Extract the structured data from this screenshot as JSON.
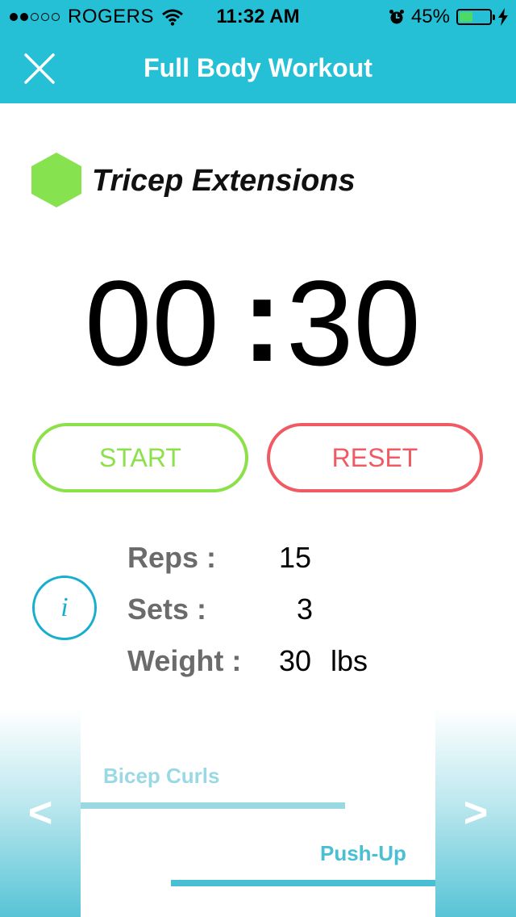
{
  "status_bar": {
    "carrier": "ROGERS",
    "time": "11:32 AM",
    "battery_percent_label": "45%",
    "battery_level": 0.45,
    "signal_bars": 2,
    "icons": [
      "signal-dots-icon",
      "wifi-icon",
      "alarm-clock-icon",
      "battery-icon",
      "charging-bolt-icon"
    ]
  },
  "header": {
    "title": "Full Body Workout",
    "close_icon": "close-icon",
    "background": "#25bfd6"
  },
  "exercise": {
    "name": "Tricep Extensions",
    "badge_icon": "hexagon-icon",
    "badge_color": "#86e34f"
  },
  "timer": {
    "minutes": "00",
    "separator": ":",
    "seconds": "30"
  },
  "buttons": {
    "start_label": "START",
    "start_color": "#8ce04a",
    "reset_label": "RESET",
    "reset_color": "#ef5a63"
  },
  "stats": {
    "info_icon": "info-icon",
    "info_glyph": "i",
    "reps_label": "Reps :",
    "reps_value": "15",
    "sets_label": "Sets :",
    "sets_value": "3",
    "weight_label": "Weight :",
    "weight_value": "30",
    "weight_unit": "lbs"
  },
  "navigation": {
    "prev_arrow": "<",
    "next_arrow": ">",
    "upper_exercise": "Bicep Curls",
    "lower_exercise": "Push-Up",
    "accent_light": "#9ad9e4",
    "accent_dark": "#48bfd2"
  }
}
